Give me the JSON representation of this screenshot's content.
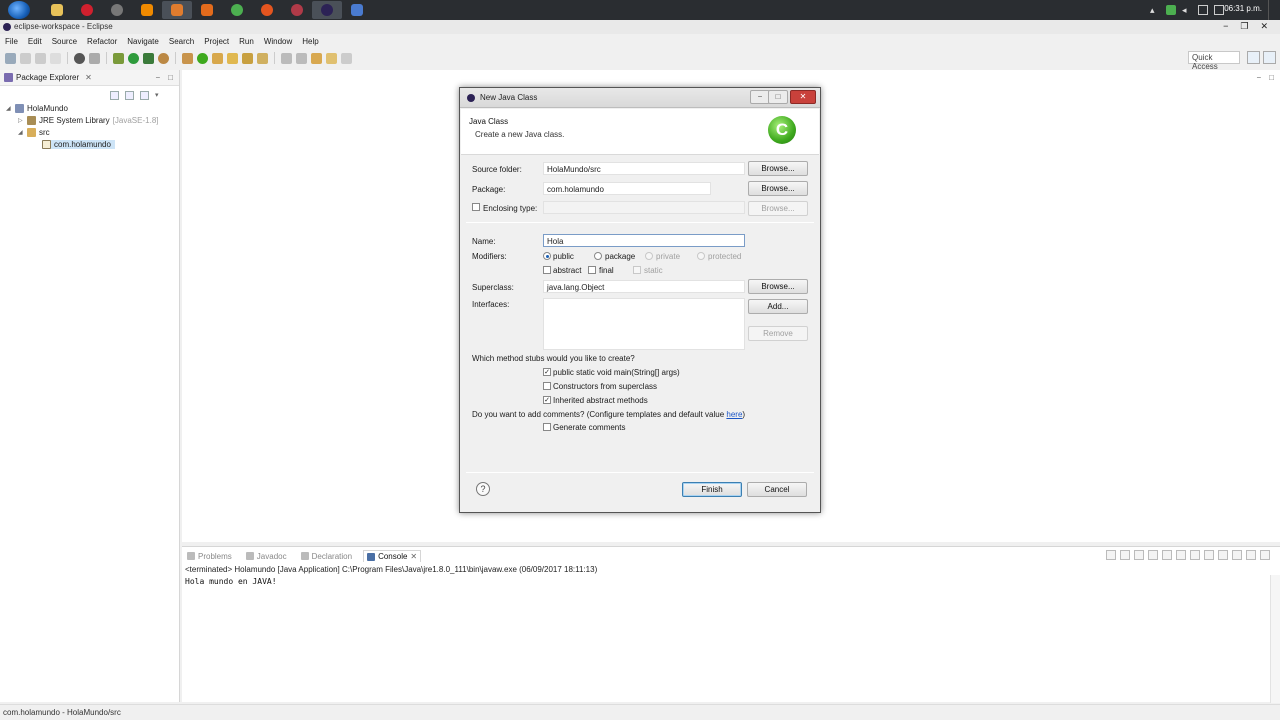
{
  "taskbar": {
    "clock": "06:31 p.m."
  },
  "window": {
    "title": "eclipse-workspace - Eclipse"
  },
  "menu": [
    "File",
    "Edit",
    "Source",
    "Refactor",
    "Navigate",
    "Search",
    "Project",
    "Run",
    "Window",
    "Help"
  ],
  "toolbar": {
    "quick_access": "Quick Access"
  },
  "package_explorer": {
    "tab_label": "Package Explorer",
    "tree": {
      "project": "HolaMundo",
      "jre_label": "JRE System Library",
      "jre_version": "[JavaSE-1.8]",
      "src": "src",
      "package": "com.holamundo"
    }
  },
  "console_view": {
    "tabs": [
      "Problems",
      "Javadoc",
      "Declaration",
      "Console"
    ],
    "terminated_line": "<terminated> Holamundo [Java Application] C:\\Program Files\\Java\\jre1.8.0_111\\bin\\javaw.exe (06/09/2017 18:11:13)",
    "output": "Hola mundo en JAVA!"
  },
  "status_bar": {
    "text": "com.holamundo - HolaMundo/src"
  },
  "dialog": {
    "title": "New Java Class",
    "header": "Java Class",
    "subtitle": "Create a new Java class.",
    "logo_letter": "C",
    "source_folder_label": "Source folder:",
    "source_folder_value": "HolaMundo/src",
    "package_label": "Package:",
    "package_value": "com.holamundo",
    "enclosing_label": "Enclosing type:",
    "enclosing_value": "",
    "browse_label": "Browse...",
    "name_label": "Name:",
    "name_value": "Hola",
    "modifiers_label": "Modifiers:",
    "mod_public": "public",
    "mod_package": "package",
    "mod_private": "private",
    "mod_protected": "protected",
    "mod_abstract": "abstract",
    "mod_final": "final",
    "mod_static": "static",
    "superclass_label": "Superclass:",
    "superclass_value": "java.lang.Object",
    "interfaces_label": "Interfaces:",
    "add_label": "Add...",
    "remove_label": "Remove",
    "stubs_question": "Which method stubs would you like to create?",
    "stub_main": "public static void main(String[] args)",
    "stub_constructors": "Constructors from superclass",
    "stub_inherited": "Inherited abstract methods",
    "comments_question": "Do you want to add comments? (Configure templates and default value",
    "comments_link": "here",
    "comments_close": ")",
    "generate_comments": "Generate comments",
    "help_symbol": "?",
    "finish_label": "Finish",
    "cancel_label": "Cancel",
    "check_mark": "✓"
  },
  "colors": {
    "accent": "#3c7fb1",
    "logo_green": "#3ea91e",
    "taskbar": "#2a2d31"
  }
}
